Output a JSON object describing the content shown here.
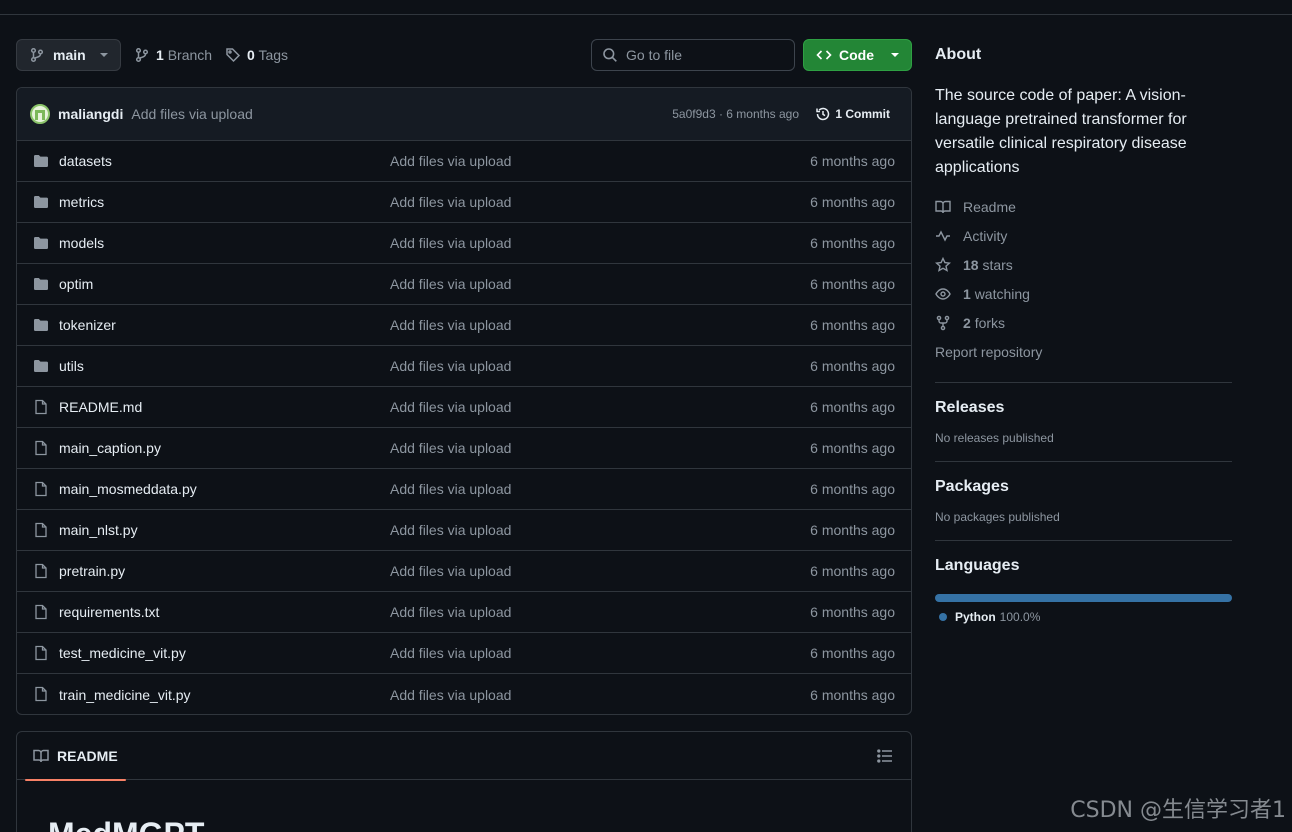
{
  "toolbar": {
    "branch_label": "main",
    "branch_count": "1",
    "branch_text": "Branch",
    "tag_count": "0",
    "tag_text": "Tags",
    "goto_placeholder": "Go to file",
    "code_label": "Code"
  },
  "latest_commit": {
    "author": "maliangdi",
    "message": "Add files via upload",
    "hash_time": "5a0f9d3 · 6 months ago",
    "commit_count": "1 Commit"
  },
  "files": [
    {
      "name": "datasets",
      "type": "folder",
      "message": "Add files via upload",
      "time": "6 months ago"
    },
    {
      "name": "metrics",
      "type": "folder",
      "message": "Add files via upload",
      "time": "6 months ago"
    },
    {
      "name": "models",
      "type": "folder",
      "message": "Add files via upload",
      "time": "6 months ago"
    },
    {
      "name": "optim",
      "type": "folder",
      "message": "Add files via upload",
      "time": "6 months ago"
    },
    {
      "name": "tokenizer",
      "type": "folder",
      "message": "Add files via upload",
      "time": "6 months ago"
    },
    {
      "name": "utils",
      "type": "folder",
      "message": "Add files via upload",
      "time": "6 months ago"
    },
    {
      "name": "README.md",
      "type": "file",
      "message": "Add files via upload",
      "time": "6 months ago"
    },
    {
      "name": "main_caption.py",
      "type": "file",
      "message": "Add files via upload",
      "time": "6 months ago"
    },
    {
      "name": "main_mosmeddata.py",
      "type": "file",
      "message": "Add files via upload",
      "time": "6 months ago"
    },
    {
      "name": "main_nlst.py",
      "type": "file",
      "message": "Add files via upload",
      "time": "6 months ago"
    },
    {
      "name": "pretrain.py",
      "type": "file",
      "message": "Add files via upload",
      "time": "6 months ago"
    },
    {
      "name": "requirements.txt",
      "type": "file",
      "message": "Add files via upload",
      "time": "6 months ago"
    },
    {
      "name": "test_medicine_vit.py",
      "type": "file",
      "message": "Add files via upload",
      "time": "6 months ago"
    },
    {
      "name": "train_medicine_vit.py",
      "type": "file",
      "message": "Add files via upload",
      "time": "6 months ago"
    }
  ],
  "readme": {
    "tab_label": "README",
    "title": "MedMGPT"
  },
  "about": {
    "heading": "About",
    "description": "The source code of paper: A vision-language pretrained transformer for versatile clinical respiratory disease applications",
    "links": [
      {
        "icon": "book-icon",
        "count": "",
        "label": "Readme"
      },
      {
        "icon": "pulse-icon",
        "count": "",
        "label": "Activity"
      },
      {
        "icon": "star-icon",
        "count": "18",
        "label": "stars"
      },
      {
        "icon": "eye-icon",
        "count": "1",
        "label": "watching"
      },
      {
        "icon": "fork-icon",
        "count": "2",
        "label": "forks"
      }
    ],
    "report": "Report repository"
  },
  "releases": {
    "heading": "Releases",
    "note": "No releases published"
  },
  "packages": {
    "heading": "Packages",
    "note": "No packages published"
  },
  "languages": {
    "heading": "Languages",
    "items": [
      {
        "name": "Python",
        "percent": "100.0%",
        "color": "#3572a5",
        "share": 1.0
      }
    ]
  },
  "watermark": "CSDN @生信学习者1"
}
